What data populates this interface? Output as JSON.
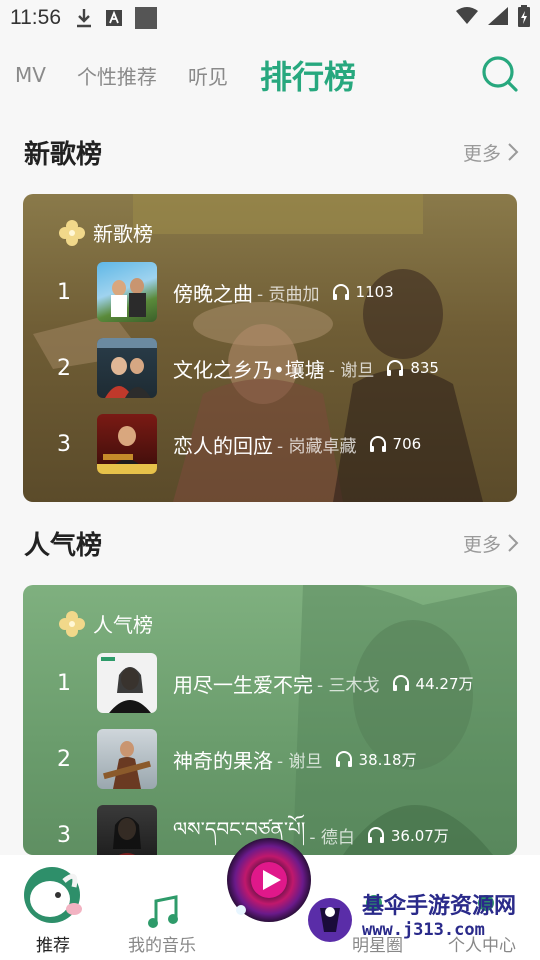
{
  "status_bar": {
    "time": "11:56"
  },
  "nav": {
    "tabs": [
      {
        "label": "MV"
      },
      {
        "label": "个性推荐"
      },
      {
        "label": "听见"
      },
      {
        "label": "排行榜"
      }
    ],
    "active_tab": "排行榜"
  },
  "section_new": {
    "title": "新歌榜",
    "more": "更多",
    "card_label": "新歌榜",
    "rows": [
      {
        "rank": "1",
        "song": "傍晚之曲",
        "artist": "- 贡曲加",
        "plays": "1103"
      },
      {
        "rank": "2",
        "song": "文化之乡乃•壤塘",
        "artist": "- 谢旦",
        "plays": "835"
      },
      {
        "rank": "3",
        "song": "恋人的回应",
        "artist": "- 岗藏卓藏",
        "plays": "706"
      }
    ]
  },
  "section_hot": {
    "title": "人气榜",
    "more": "更多",
    "card_label": "人气榜",
    "rows": [
      {
        "rank": "1",
        "song": "用尽一生爱不完",
        "artist": "- 三木戈",
        "plays": "44.27万"
      },
      {
        "rank": "2",
        "song": "神奇的果洛",
        "artist": "- 谢旦",
        "plays": "38.18万"
      },
      {
        "rank": "3",
        "song": "ལས་དབང་བཙན་པོ།",
        "artist": "- 德白",
        "plays": "36.07万"
      }
    ]
  },
  "bottom_nav": {
    "items": [
      {
        "label": "推荐"
      },
      {
        "label": "我的音乐"
      },
      {
        "label": "明星圈"
      },
      {
        "label": "个人中心"
      }
    ]
  },
  "watermark": {
    "line1": "基伞手游资源网",
    "line2": "www.j313.com"
  },
  "colors": {
    "accent": "#27a87e",
    "card_new": "#6f5d35",
    "card_hot": "#6a9c6c"
  }
}
